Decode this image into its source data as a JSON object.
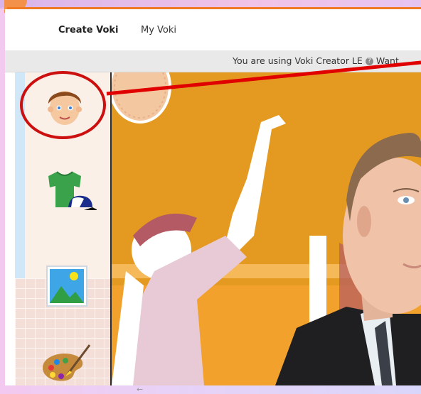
{
  "nav": {
    "items": [
      {
        "label": "Create Voki",
        "active": true
      },
      {
        "label": "My Voki",
        "active": false
      }
    ]
  },
  "notice": {
    "text": "You are using Voki Creator LE",
    "help_icon": "?",
    "trailing": "Want"
  },
  "sidebar": {
    "buttons": [
      {
        "name": "character-head-icon"
      },
      {
        "name": "clothing-icon"
      },
      {
        "name": "background-image-icon"
      },
      {
        "name": "color-palette-icon"
      }
    ]
  },
  "footer": {
    "arrow": "←"
  },
  "colors": {
    "accent_orange": "#f07a24",
    "stage_orange": "#e49a21",
    "annotation_red": "#cc1010"
  }
}
